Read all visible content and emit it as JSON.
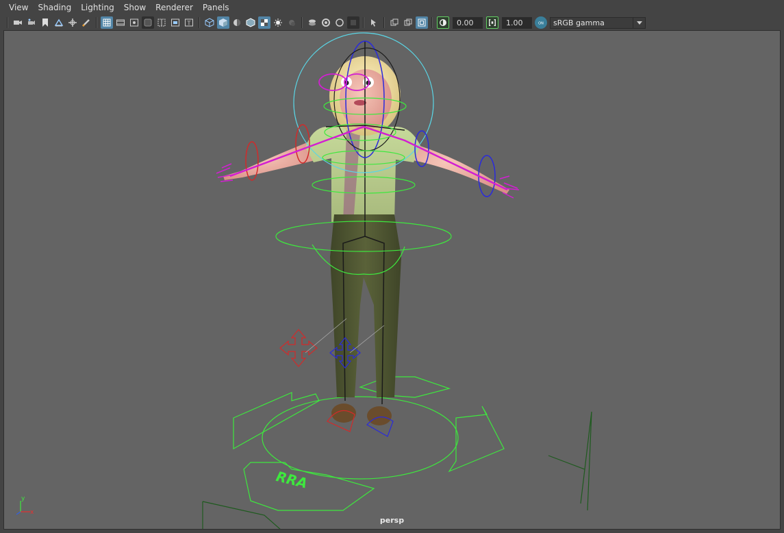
{
  "menu": {
    "view": "View",
    "shading": "Shading",
    "lighting": "Lighting",
    "show": "Show",
    "renderer": "Renderer",
    "panels": "Panels"
  },
  "toolbar": {
    "exposure_value": "0.00",
    "gamma_value": "1.00",
    "color_space": "sRGB gamma",
    "icons": [
      "camera-icon",
      "camera-attributes-icon",
      "bookmark-icon",
      "image-plane-icon",
      "pan-zoom-icon",
      "grease-pencil-icon",
      "grid-icon",
      "film-gate-icon",
      "resolution-gate-icon",
      "gate-mask-icon",
      "field-chart-icon",
      "safe-action-icon",
      "safe-title-icon",
      "wireframe-icon",
      "smooth-shade-icon",
      "bounding-box-icon",
      "wireframe-on-shaded-icon",
      "textured-icon",
      "lights-icon",
      "shadows-icon",
      "isolate-select-icon",
      "xray-icon",
      "xray-joints-icon",
      "xray-components-icon",
      "camera-select-icon",
      "two-pane-icon",
      "four-pane-icon",
      "hud-icon",
      "exposure-icon",
      "gamma-icon",
      "color-management-icon"
    ]
  },
  "colors": {
    "viewport_bg": "#646464",
    "ui_bg": "#444444",
    "active_button": "#5285a6",
    "rig_green": "#3ee83e",
    "rig_magenta": "#d21fd2",
    "rig_blue": "#2a2adc",
    "rig_red": "#d22a2a"
  },
  "viewport": {
    "camera_label": "persp",
    "ground_label": "RRA",
    "axis_y": "y",
    "axis_x": "x"
  }
}
